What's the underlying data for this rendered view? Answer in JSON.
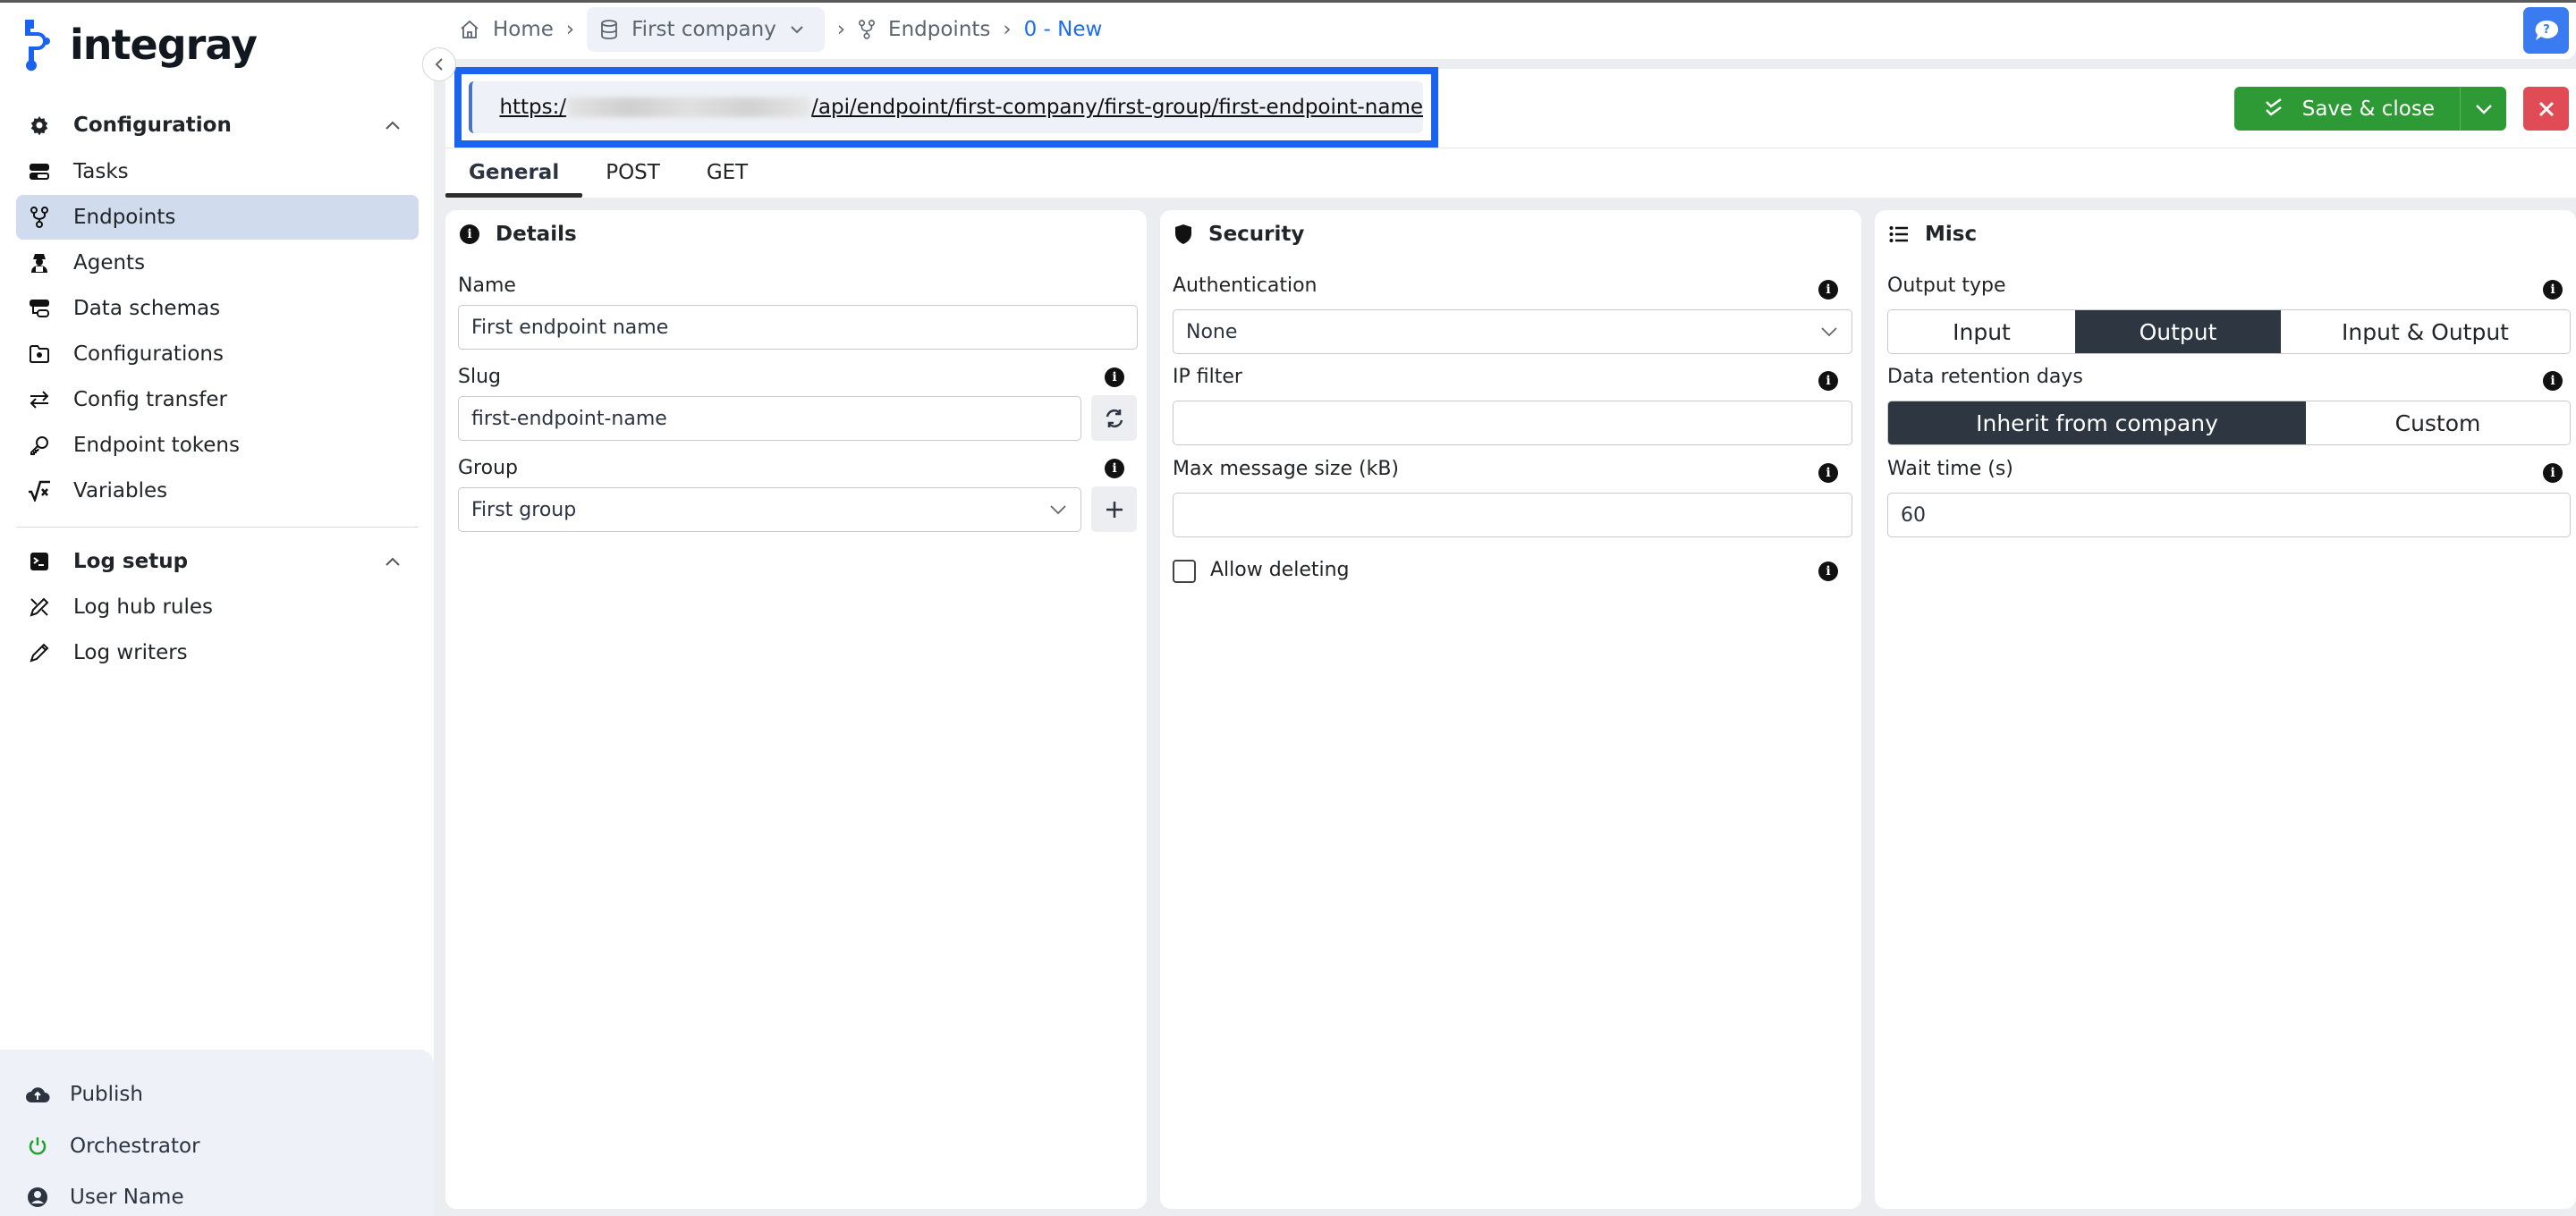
{
  "app": {
    "brand": "integray"
  },
  "sidebar": {
    "sections": [
      {
        "label": "Configuration",
        "items": [
          {
            "label": "Tasks",
            "icon": "tasks-icon"
          },
          {
            "label": "Endpoints",
            "icon": "endpoints-icon",
            "active": true
          },
          {
            "label": "Agents",
            "icon": "agent-icon"
          },
          {
            "label": "Data schemas",
            "icon": "data-schema-icon"
          },
          {
            "label": "Configurations",
            "icon": "folder-gear-icon"
          },
          {
            "label": "Config transfer",
            "icon": "transfer-icon"
          },
          {
            "label": "Endpoint tokens",
            "icon": "key-icon"
          },
          {
            "label": "Variables",
            "icon": "square-root-variable-icon"
          }
        ]
      },
      {
        "label": "Log setup",
        "items": [
          {
            "label": "Log hub rules",
            "icon": "pen-ruler-icon"
          },
          {
            "label": "Log writers",
            "icon": "pencil-icon"
          }
        ]
      }
    ],
    "bottom": [
      {
        "label": "Publish",
        "icon": "cloud-upload-icon"
      },
      {
        "label": "Orchestrator",
        "icon": "power-icon",
        "status_color": "#23a12e"
      },
      {
        "label": "User Name",
        "icon": "user-circle-icon"
      }
    ]
  },
  "breadcrumb": {
    "home": "Home",
    "company": "First company",
    "section": "Endpoints",
    "current": "0 - New"
  },
  "header": {
    "url_prefix": "https:/",
    "url_suffix": "/api/endpoint/first-company/first-group/first-endpoint-name",
    "save_label": "Save & close",
    "accent_color": "#1a62f0",
    "save_color": "#2e9a36",
    "close_color": "#e04b56"
  },
  "tabs": [
    {
      "label": "General",
      "active": true
    },
    {
      "label": "POST",
      "active": false
    },
    {
      "label": "GET",
      "active": false
    }
  ],
  "details": {
    "title": "Details",
    "name_label": "Name",
    "name_value": "First endpoint name",
    "slug_label": "Slug",
    "slug_value": "first-endpoint-name",
    "group_label": "Group",
    "group_value": "First group"
  },
  "security": {
    "title": "Security",
    "auth_label": "Authentication",
    "auth_value": "None",
    "ip_label": "IP filter",
    "ip_value": "",
    "max_label": "Max message size (kB)",
    "max_value": "",
    "allow_deleting_label": "Allow deleting",
    "allow_deleting_checked": false
  },
  "misc": {
    "title": "Misc",
    "output_type_label": "Output type",
    "output_type_options": [
      "Input",
      "Output",
      "Input & Output"
    ],
    "output_type_selected": "Output",
    "retention_label": "Data retention days",
    "retention_options": [
      "Inherit from company",
      "Custom"
    ],
    "retention_selected": "Inherit from company",
    "wait_label": "Wait time (s)",
    "wait_value": "60"
  }
}
